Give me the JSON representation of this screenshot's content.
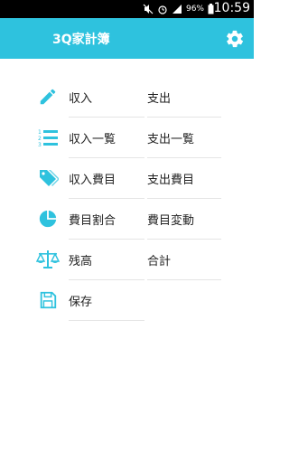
{
  "status_bar": {
    "battery_percent": "96%",
    "time": "10:59"
  },
  "app_bar": {
    "title": "3Q家計簿",
    "accent_color": "#2ec2de",
    "settings_icon": "gear-icon"
  },
  "menu": {
    "rows": [
      {
        "icon": "pencil-icon",
        "left": "収入",
        "right": "支出"
      },
      {
        "icon": "numbered-list-icon",
        "left": "収入一覧",
        "right": "支出一覧"
      },
      {
        "icon": "tag-icon",
        "left": "収入費目",
        "right": "支出費目"
      },
      {
        "icon": "pie-chart-icon",
        "left": "費目割合",
        "right": "費目変動"
      },
      {
        "icon": "scale-icon",
        "left": "残高",
        "right": "合計"
      },
      {
        "icon": "floppy-disk-icon",
        "left": "保存",
        "right": ""
      }
    ]
  }
}
